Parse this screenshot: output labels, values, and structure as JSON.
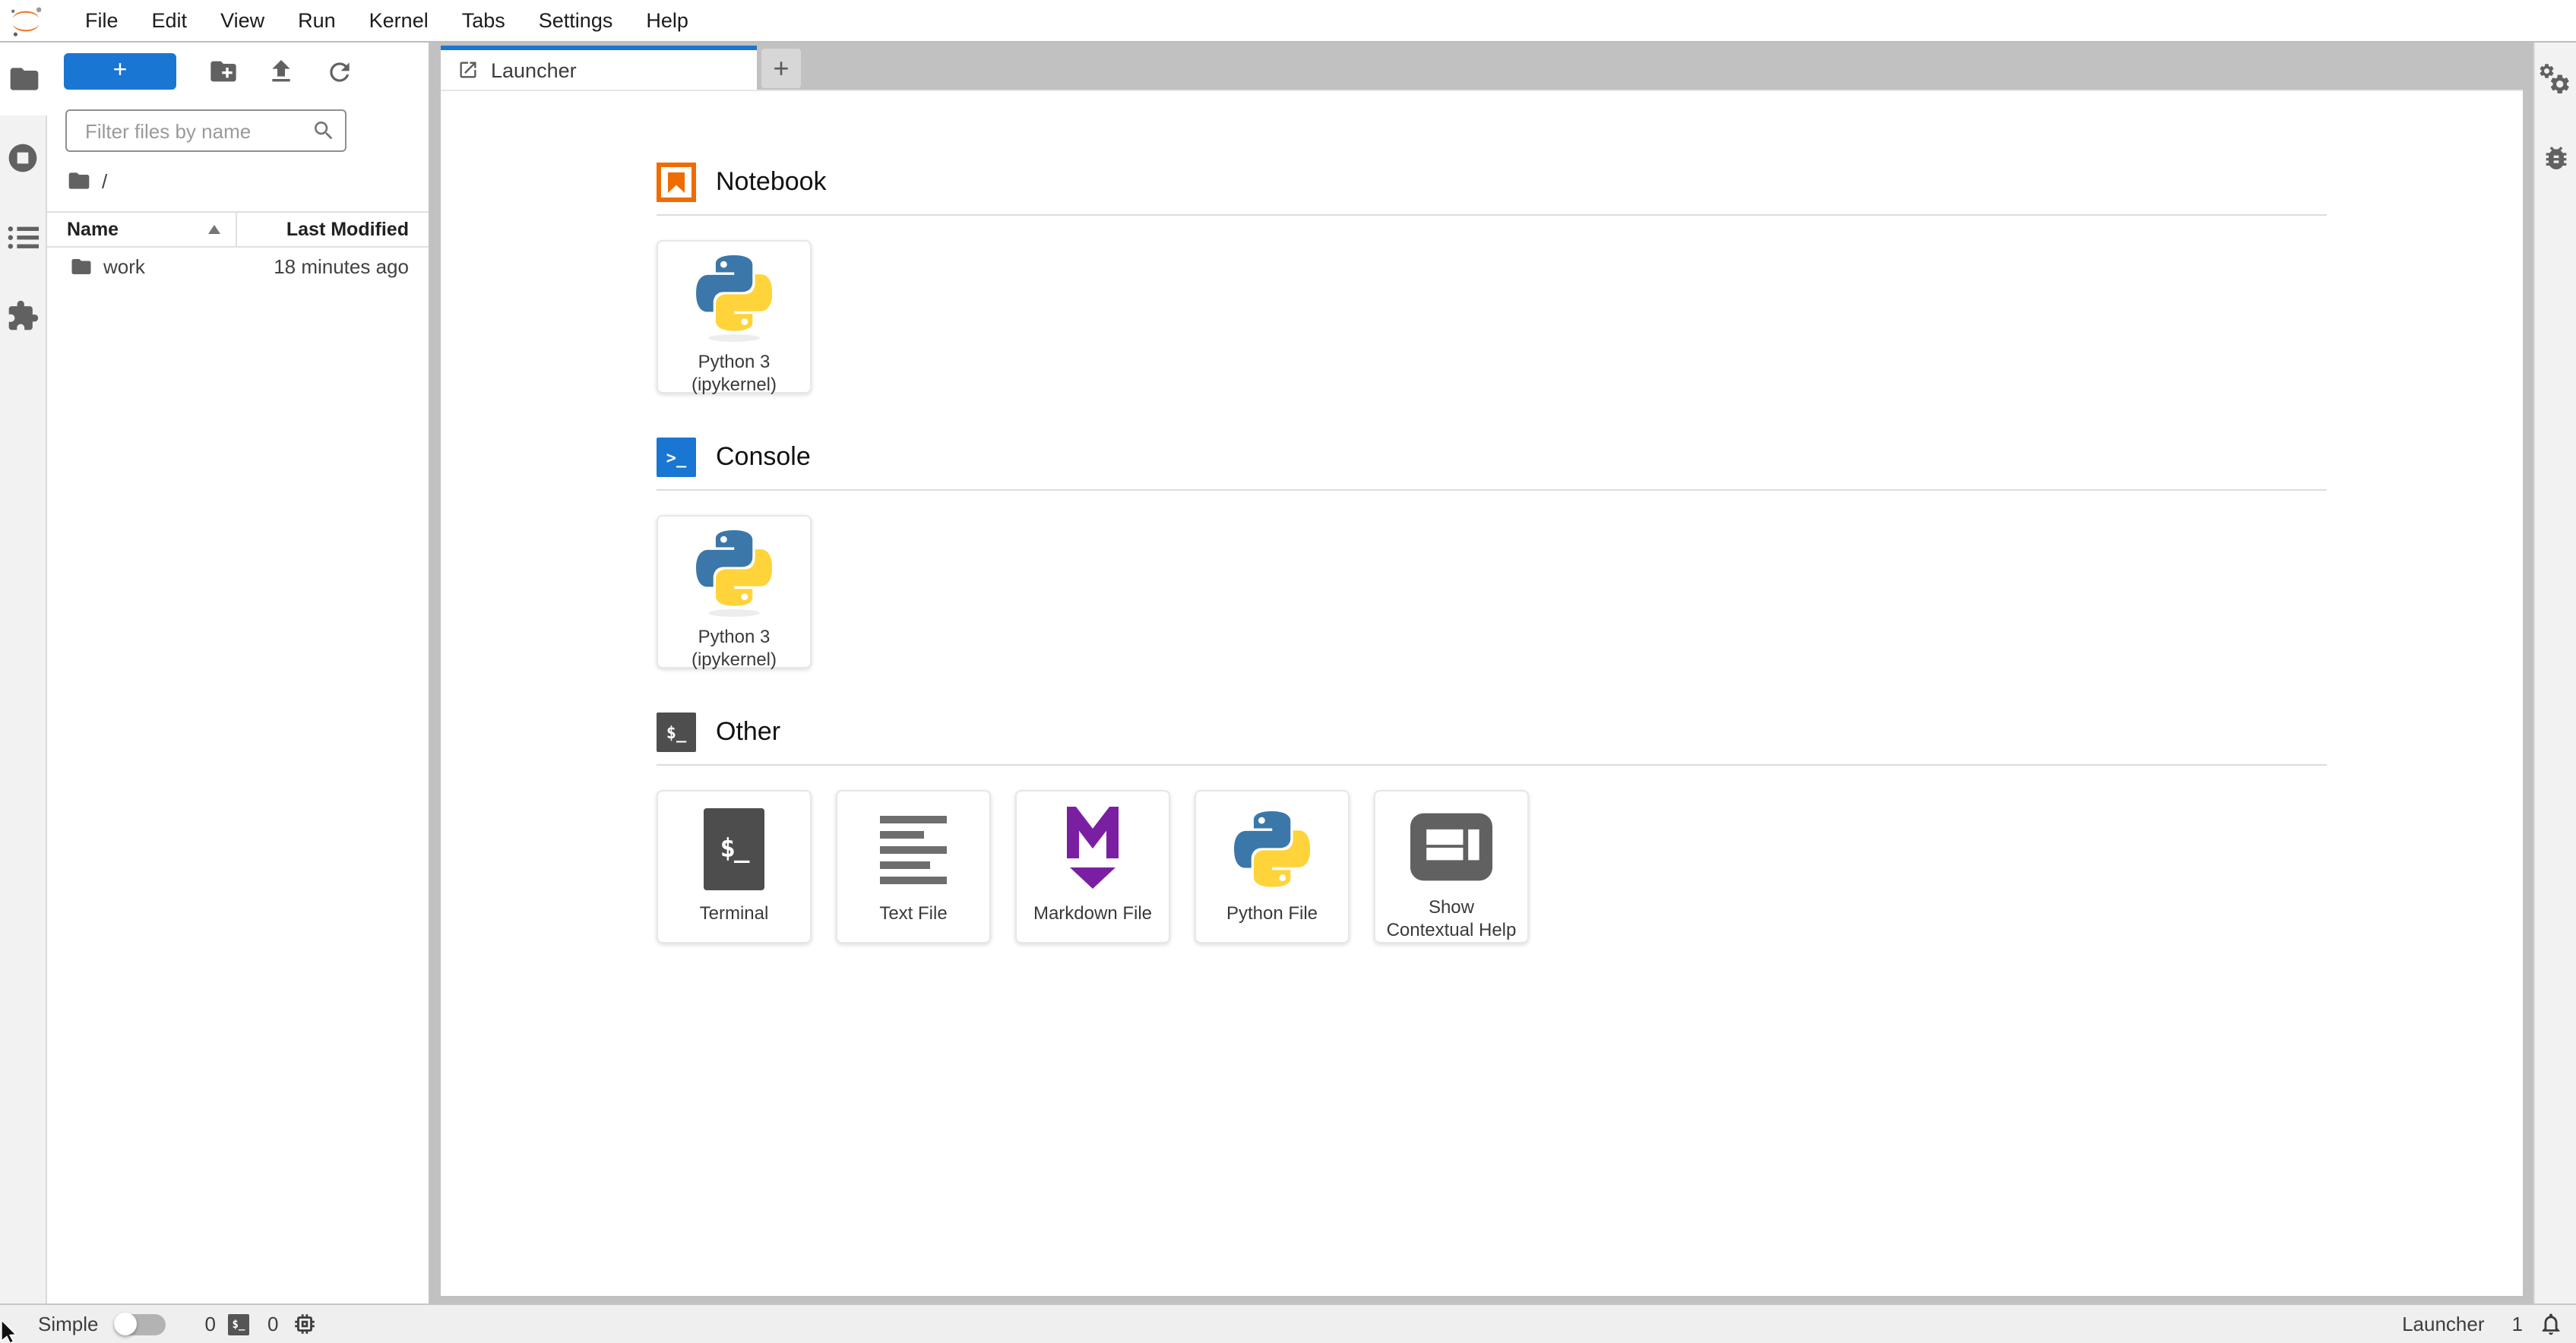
{
  "menubar": {
    "items": [
      "File",
      "Edit",
      "View",
      "Run",
      "Kernel",
      "Tabs",
      "Settings",
      "Help"
    ]
  },
  "left_sidebar": {
    "tabs": [
      "file-browser",
      "running-sessions",
      "table-of-contents",
      "extension-manager"
    ]
  },
  "right_sidebar": {
    "tabs": [
      "property-inspector",
      "debugger"
    ]
  },
  "file_browser": {
    "new_launcher_label": "+",
    "filter_placeholder": "Filter files by name",
    "breadcrumb_root": "/",
    "columns": [
      "Name",
      "Last Modified"
    ],
    "rows": [
      {
        "name": "work",
        "modified": "18 minutes ago",
        "icon": "folder-icon"
      }
    ]
  },
  "dock": {
    "tabs": [
      {
        "label": "Launcher",
        "icon": "launch-icon",
        "active": true
      }
    ],
    "add_tab_label": "+"
  },
  "launcher": {
    "sections": [
      {
        "title": "Notebook",
        "icon": "notebook-icon",
        "cards": [
          {
            "id": "notebook-python3",
            "icon": "python-logo",
            "lines": [
              "Python 3",
              "(ipykernel)"
            ]
          }
        ]
      },
      {
        "title": "Console",
        "icon": "console-icon",
        "cards": [
          {
            "id": "console-python3",
            "icon": "python-logo",
            "lines": [
              "Python 3",
              "(ipykernel)"
            ]
          }
        ]
      },
      {
        "title": "Other",
        "icon": "terminal-icon",
        "cards": [
          {
            "id": "terminal",
            "icon": "terminal-icon",
            "lines": [
              "Terminal"
            ]
          },
          {
            "id": "text-file",
            "icon": "text-lines-icon",
            "lines": [
              "Text File"
            ]
          },
          {
            "id": "markdown-file",
            "icon": "markdown-icon",
            "lines": [
              "Markdown File"
            ]
          },
          {
            "id": "python-file",
            "icon": "python-logo",
            "lines": [
              "Python File"
            ]
          },
          {
            "id": "contextual-help",
            "icon": "layout-panes-icon",
            "lines": [
              "Show",
              "Contextual Help"
            ]
          }
        ]
      }
    ]
  },
  "status_bar": {
    "mode_label": "Simple",
    "mode_toggle_on": false,
    "terminals_count": "0",
    "kernels_count": "0",
    "current_activity": "Launcher",
    "notifications_count": "1"
  },
  "glyphs": {
    "terminal_prompt": "$_",
    "console_prompt": ">_"
  },
  "colors": {
    "accent_blue": "#1976d2",
    "jupyter_orange": "#F37626",
    "notebook_orange": "#EF6C00",
    "markdown_purple": "#7B1FA2",
    "python_blue": "#306998",
    "python_yellow": "#FFD43B",
    "terminal_dark": "#4d4d4d",
    "icon_gray": "#616161",
    "tabbar_gray": "#c1c1c1"
  }
}
